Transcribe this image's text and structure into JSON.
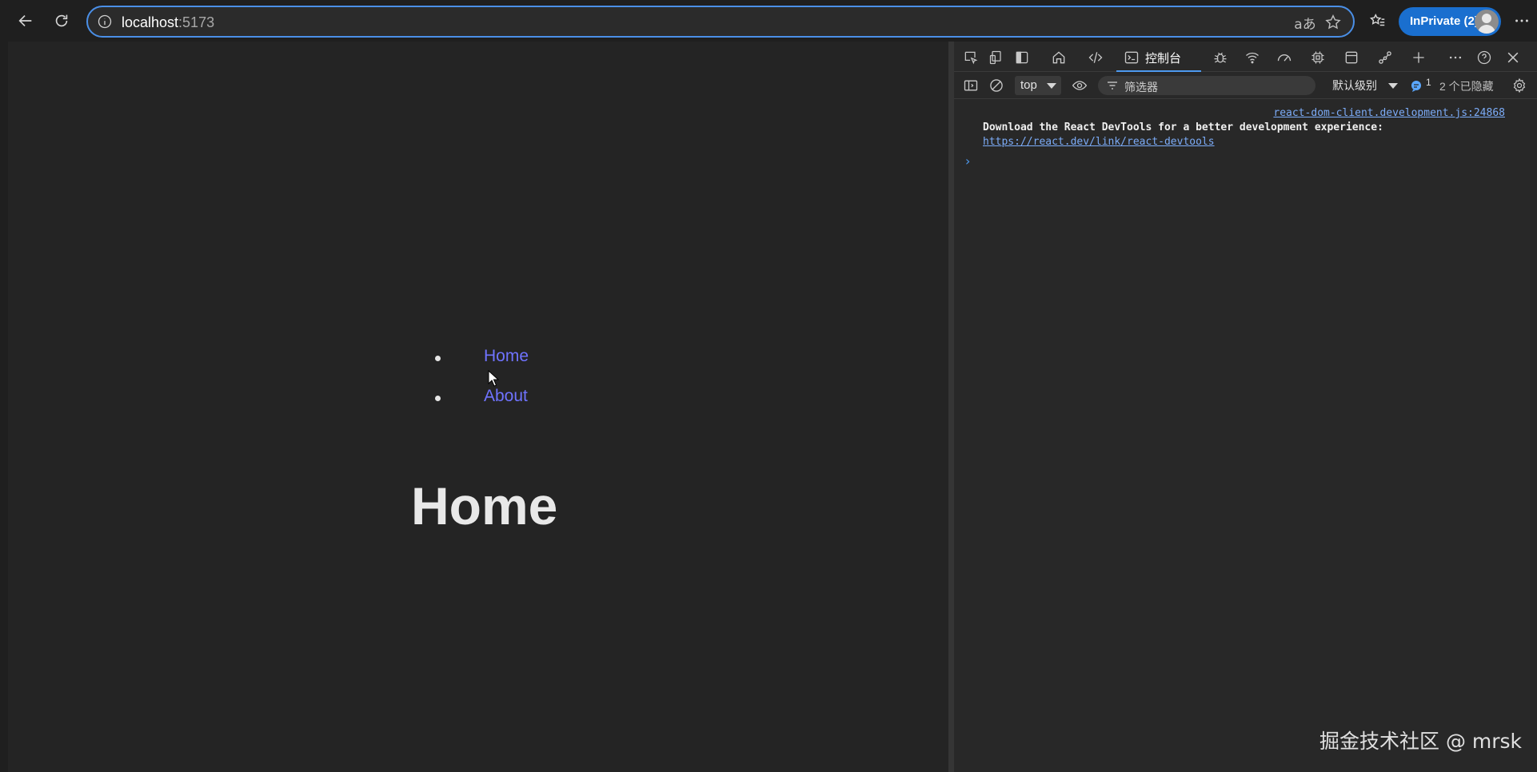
{
  "browser": {
    "url_host": "localhost",
    "url_port": ":5173",
    "inprivate_label": "InPrivate (2)",
    "translate_glyph": "aあ",
    "accent_color": "#4a8fe7"
  },
  "page": {
    "nav": [
      {
        "label": "Home",
        "color": "#6f73ff"
      },
      {
        "label": "About",
        "color": "#6f73ff"
      }
    ],
    "heading": "Home",
    "background": "#242424"
  },
  "devtools": {
    "tabs": {
      "console_label": "控制台"
    },
    "toolbar": {
      "context": "top",
      "filter_placeholder": "筛选器",
      "level": "默认级别",
      "issues_count": "1",
      "hidden": "2 个已隐藏"
    },
    "console": {
      "source": "react-dom-client.development.js:24868",
      "message": "Download the React DevTools for a better development experience:",
      "link": "https://react.dev/link/react-devtools",
      "prompt": "›"
    }
  },
  "watermark": "掘金技术社区 @ mrsk"
}
